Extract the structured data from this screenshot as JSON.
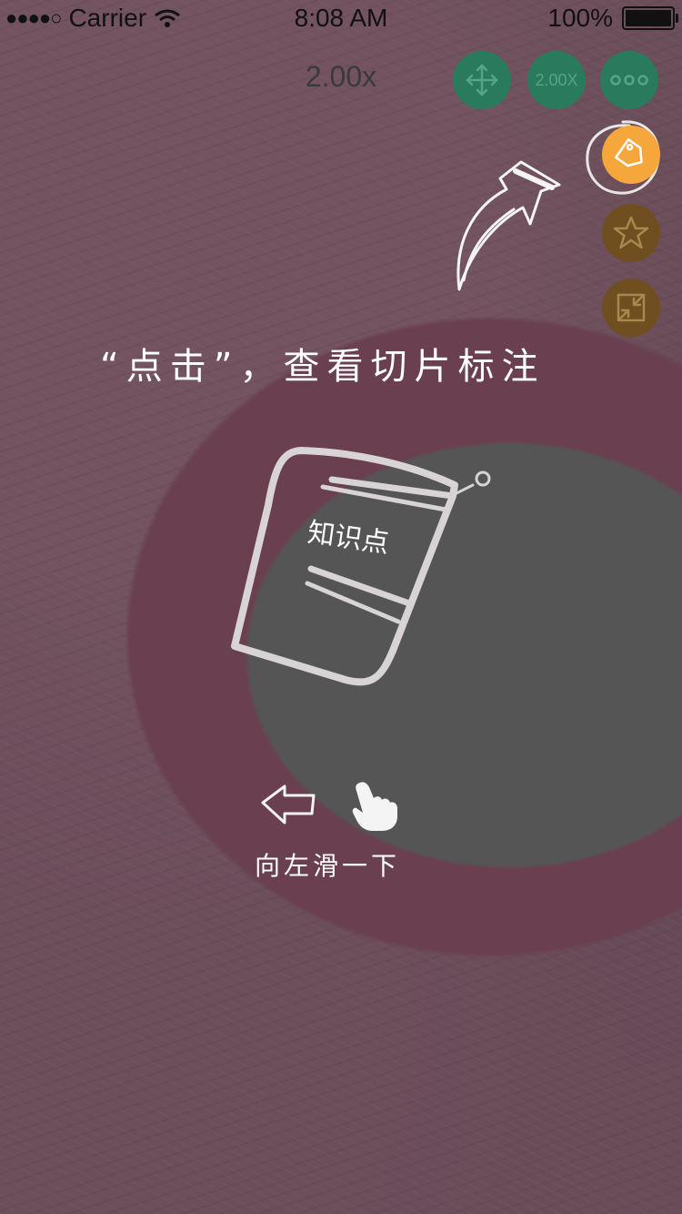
{
  "status_bar": {
    "signal": "●●●●○",
    "carrier": "Carrier",
    "time": "8:08 AM",
    "battery": "100%"
  },
  "viewer": {
    "zoom_readout": "2.00x"
  },
  "toolbar": {
    "move_icon": "move-arrows-icon",
    "zoom_button_label": "2.00X",
    "more_icon": "more-dots-icon",
    "annotation_icon": "tag-icon",
    "favorite_icon": "star-icon",
    "collapse_icon": "collapse-icon",
    "colors": {
      "green": "#2a7a5e",
      "orange": "#f6a73b",
      "brown": "#6f4e20"
    }
  },
  "tutorial": {
    "tap_hint": "“点击”，查看切片标注",
    "card_label": "知识点",
    "swipe_hint": "向左滑一下"
  }
}
